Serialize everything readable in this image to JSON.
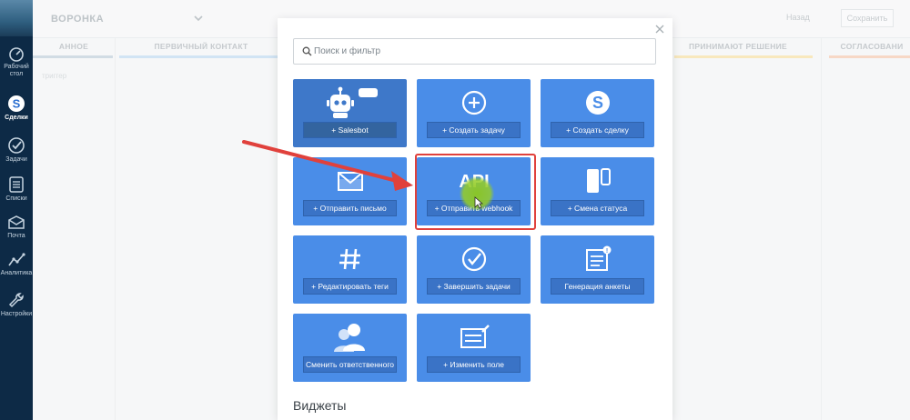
{
  "sidebar": {
    "items": [
      {
        "label_lines": [
          "Рабочий",
          "стол"
        ],
        "icon": "dashboard-icon",
        "active": false
      },
      {
        "label_lines": [
          "Сделки"
        ],
        "icon": "deals-icon",
        "active": true
      },
      {
        "label_lines": [
          "Задачи"
        ],
        "icon": "tasks-icon",
        "active": false
      },
      {
        "label_lines": [
          "Списки"
        ],
        "icon": "lists-icon",
        "active": false
      },
      {
        "label_lines": [
          "Почта"
        ],
        "icon": "mail-icon",
        "active": false
      },
      {
        "label_lines": [
          "Аналитика"
        ],
        "icon": "analytics-icon",
        "active": false
      },
      {
        "label_lines": [
          "Настройки"
        ],
        "icon": "settings-icon",
        "active": false
      }
    ]
  },
  "board": {
    "pipeline_name": "ВОРОНКА",
    "back_label": "Назад",
    "save_label": "Сохранить",
    "columns": [
      {
        "title": "АННОЕ",
        "color": "#b9c9d6"
      },
      {
        "title": "ПЕРВИЧНЫЙ КОНТАКТ",
        "color": "#b9d6ee"
      },
      {
        "title": "ПРИНИМАЮТ РЕШЕНИЕ",
        "color": "#f5dc9a"
      },
      {
        "title": "СОГЛАСОВАНИ",
        "color": "#f3c3a8"
      }
    ],
    "faded_text": "триггер"
  },
  "modal": {
    "search_placeholder": "Поиск и фильтр",
    "tiles": [
      {
        "label": "+ Salesbot",
        "icon": "robot-icon"
      },
      {
        "label": "+ Создать задачу",
        "icon": "plus-circle-icon"
      },
      {
        "label": "+ Создать сделку",
        "icon": "dollar-icon"
      },
      {
        "label": "+ Отправить письмо",
        "icon": "envelope-icon"
      },
      {
        "label": "+ Отправить webhook",
        "icon": "api-icon",
        "icon_text": "API"
      },
      {
        "label": "+ Смена статуса",
        "icon": "status-change-icon"
      },
      {
        "label": "+ Редактировать теги",
        "icon": "hashtag-icon"
      },
      {
        "label": "+ Завершить задачи",
        "icon": "check-circle-icon"
      },
      {
        "label": "Генерация анкеты",
        "icon": "form-icon"
      },
      {
        "label": "Сменить ответственного",
        "icon": "users-icon"
      },
      {
        "label": "+ Изменить поле",
        "icon": "edit-field-icon"
      }
    ],
    "widgets_title": "Виджеты"
  },
  "colors": {
    "tile": "#4a8de8",
    "tile_dark": "#3e78c9",
    "highlight": "#e0413c",
    "sidebar": "#0d2a46"
  }
}
